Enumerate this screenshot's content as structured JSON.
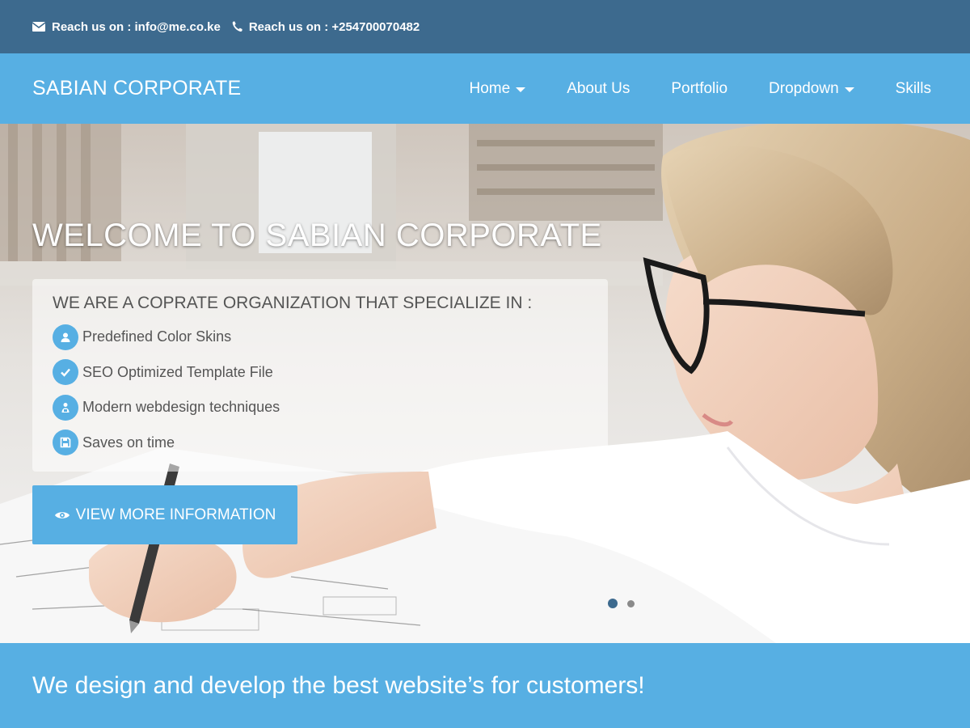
{
  "topbar": {
    "email_label": "Reach us on : info@me.co.ke",
    "phone_label": "Reach us on : +254700070482"
  },
  "navbar": {
    "brand": "SABIAN CORPORATE",
    "items": [
      {
        "label": "Home",
        "dropdown": true
      },
      {
        "label": "About Us",
        "dropdown": false
      },
      {
        "label": "Portfolio",
        "dropdown": false
      },
      {
        "label": "Dropdown",
        "dropdown": true
      },
      {
        "label": "Skills",
        "dropdown": false
      }
    ]
  },
  "hero": {
    "title": "WELCOME TO SABIAN CORPORATE",
    "panel_title": "WE ARE A COPRATE ORGANIZATION THAT SPECIALIZE IN :",
    "features": [
      {
        "icon": "user-icon",
        "label": "Predefined Color Skins"
      },
      {
        "icon": "check-icon",
        "label": "SEO Optimized Template File"
      },
      {
        "icon": "users-icon",
        "label": "Modern webdesign techniques"
      },
      {
        "icon": "floppy-disk-icon",
        "label": "Saves on time"
      }
    ],
    "cta_label": "VIEW MORE INFORMATION",
    "cta_icon": "eye-icon",
    "slides_total": 2,
    "active_slide": 1
  },
  "banner": {
    "text": "We design and develop the best website’s for customers!"
  },
  "colors": {
    "topbar_bg": "#3d6a8e",
    "accent": "#57afe3",
    "text_dark": "#555555"
  }
}
